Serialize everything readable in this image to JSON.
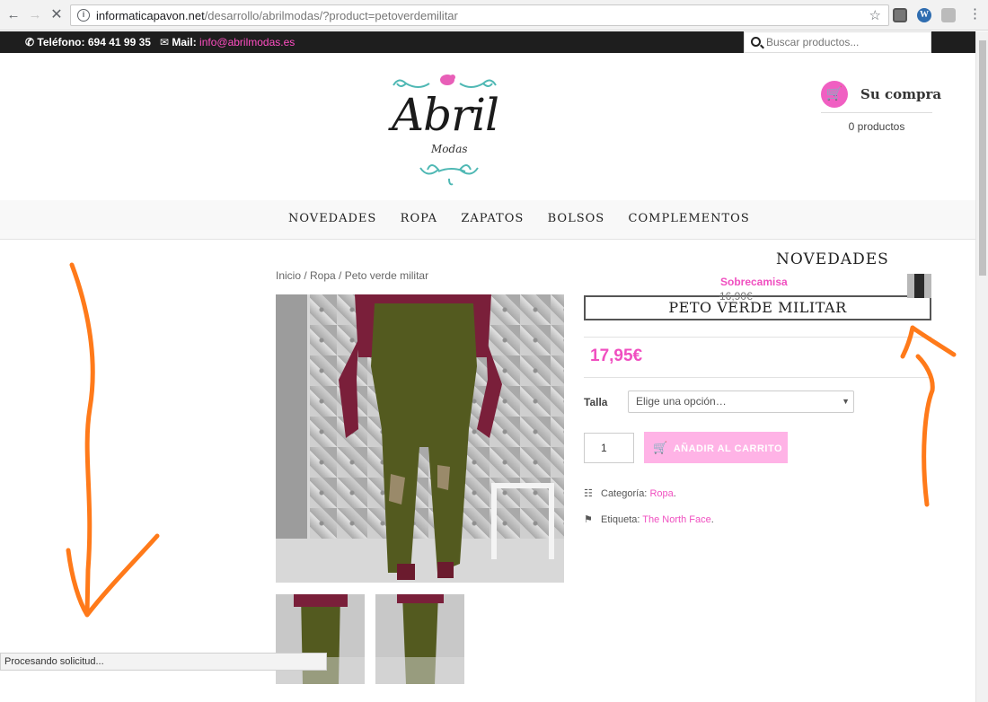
{
  "browser": {
    "url_domain": "informaticapavon.net",
    "url_rest": "/desarrollo/abrilmodas/?product=petoverdemilitar",
    "status_text": "Procesando solicitud..."
  },
  "topbar": {
    "phone_label": "Teléfono:",
    "phone_value": "694 41 99 35",
    "mail_label": "Mail:",
    "mail_value": "info@abrilmodas.es",
    "search_placeholder": "Buscar productos..."
  },
  "logo": {
    "name": "Abril",
    "sub": "Modas"
  },
  "cart": {
    "title": "Su compra",
    "count": "0 productos"
  },
  "menu": {
    "items": [
      "NOVEDADES",
      "ROPA",
      "ZAPATOS",
      "BOLSOS",
      "COMPLEMENTOS"
    ]
  },
  "breadcrumb": "Inicio / Ropa / Peto verde militar",
  "product": {
    "title": "PETO VERDE MILITAR",
    "price": "17,95€",
    "size_label": "Talla",
    "size_select": "Elige una opción…",
    "quantity": "1",
    "add_to_cart": "AÑADIR AL CARRITO",
    "category_label": "Categoría:",
    "category_value": "Ropa",
    "tag_label": "Etiqueta:",
    "tag_value": "The North Face"
  },
  "sidebar": {
    "widget_title": "NOVEDADES",
    "item_name": "Sobrecamisa",
    "item_price": "16,90€"
  },
  "colors": {
    "accent_pink": "#f04fc0",
    "button_pink": "#ffb3e6",
    "topbar_dark": "#1e1e1e",
    "annotation_orange": "#ff7a1a"
  }
}
